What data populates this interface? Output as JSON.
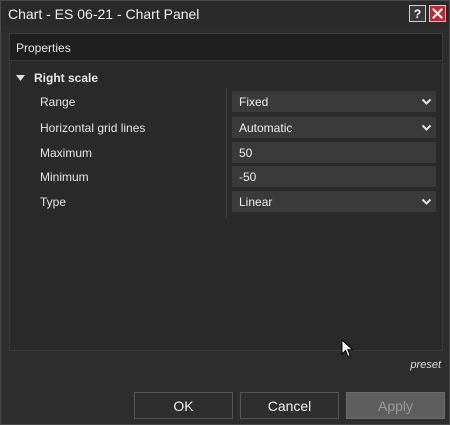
{
  "window": {
    "title": "Chart - ES 06-21 - Chart Panel",
    "help_label": "?"
  },
  "panel": {
    "header": "Properties",
    "section": {
      "label": "Right scale",
      "expanded": true
    },
    "properties": [
      {
        "label": "Range",
        "value": "Fixed",
        "kind": "dropdown"
      },
      {
        "label": "Horizontal grid lines",
        "value": "Automatic",
        "kind": "dropdown"
      },
      {
        "label": "Maximum",
        "value": "50",
        "kind": "input"
      },
      {
        "label": "Minimum",
        "value": "-50",
        "kind": "input"
      },
      {
        "label": "Type",
        "value": "Linear",
        "kind": "dropdown"
      }
    ]
  },
  "footer": {
    "preset_label": "preset",
    "ok_label": "OK",
    "cancel_label": "Cancel",
    "apply_label": "Apply",
    "apply_enabled": false
  },
  "icons": {
    "close": "close-icon",
    "dropdown": "chevron-down-icon",
    "caret": "triangle-down-icon",
    "cursor": "mouse-pointer-icon"
  },
  "colors": {
    "close_button": "#c1272d",
    "background": "#2d2d2d",
    "field": "#3a3a3a"
  }
}
